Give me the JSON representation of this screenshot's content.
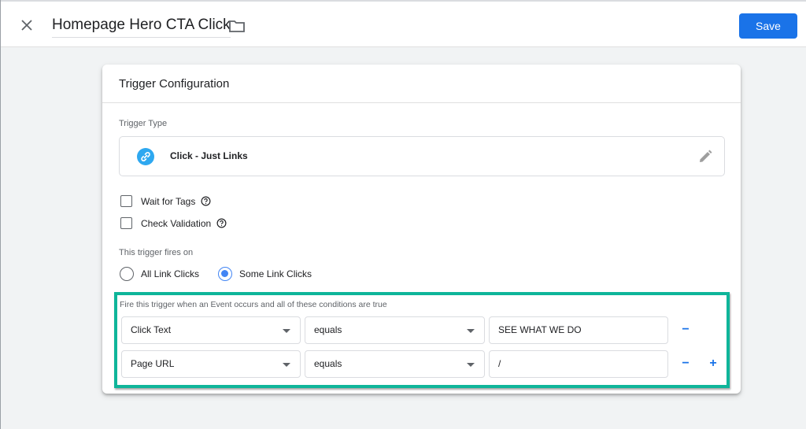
{
  "header": {
    "close_icon": "close-icon",
    "title": "Homepage Hero CTA Click",
    "folder_icon": "folder-icon",
    "save_label": "Save"
  },
  "card": {
    "title": "Trigger Configuration",
    "trigger_type_label": "Trigger Type",
    "trigger_type": {
      "icon": "link-icon",
      "name": "Click - Just Links",
      "edit_icon": "pencil-icon",
      "icon_color": "#2ea8f0"
    },
    "options": [
      {
        "label": "Wait for Tags",
        "checked": false,
        "help_icon": "help-icon"
      },
      {
        "label": "Check Validation",
        "checked": false,
        "help_icon": "help-icon"
      }
    ],
    "fires_on_label": "This trigger fires on",
    "fires_on": [
      {
        "label": "All Link Clicks",
        "selected": false
      },
      {
        "label": "Some Link Clicks",
        "selected": true
      }
    ],
    "conditions": {
      "title": "Fire this trigger when an Event occurs and all of these conditions are true",
      "highlight_color": "#0fb59a",
      "rows": [
        {
          "variable": "Click Text",
          "operator": "equals",
          "value": "SEE WHAT WE DO",
          "remove_label": "−",
          "add_label": ""
        },
        {
          "variable": "Page URL",
          "operator": "equals",
          "value": "/",
          "remove_label": "−",
          "add_label": "+"
        }
      ]
    }
  },
  "colors": {
    "accent": "#1a73e8",
    "background": "#f1f3f4"
  }
}
